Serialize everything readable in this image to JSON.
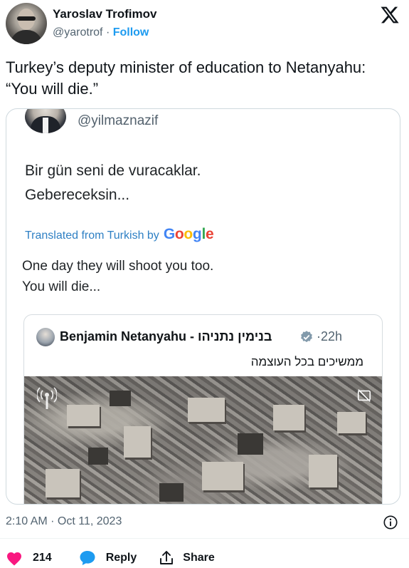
{
  "author": {
    "name": "Yaroslav Trofimov",
    "handle": "@yarotrof",
    "separator": "·",
    "follow_label": "Follow"
  },
  "brand_icon": "x-logo-icon",
  "tweet_text": "Turkey’s deputy minister of education to Netanyahu: “You will die.”",
  "embedded": {
    "handle": "@yilmaznazif",
    "original_line_1": "Bir gün seni de vuracaklar.",
    "original_line_2": "Gebereceksin...",
    "translated_from": "Translated from Turkish by",
    "google_letters": [
      "G",
      "o",
      "o",
      "g",
      "l",
      "e"
    ],
    "translation_line_1": "One day they will shoot you too.",
    "translation_line_2": "You will die...",
    "quoted": {
      "name": "Benjamin Netanyahu - בנימין נתניהו",
      "verified_icon": "verified-badge-icon",
      "separator": "·",
      "time": "22h",
      "text": "ממשיכים בכל העוצמה",
      "media_icons": [
        "broadcast-icon",
        "captions-off-icon"
      ]
    }
  },
  "timestamp": "2:10 AM · Oct 11, 2023",
  "actions": {
    "likes": "214",
    "reply_label": "Reply",
    "share_label": "Share"
  },
  "colors": {
    "accent": "#1d9bf0",
    "like": "#f91880",
    "muted": "#536471",
    "translate_link": "#2f80c4"
  }
}
